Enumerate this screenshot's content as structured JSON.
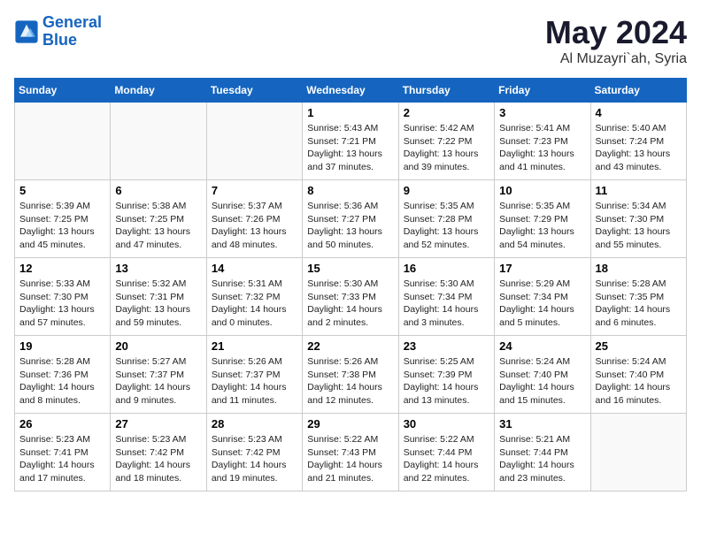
{
  "header": {
    "logo_line1": "General",
    "logo_line2": "Blue",
    "month": "May 2024",
    "location": "Al Muzayri`ah, Syria"
  },
  "weekdays": [
    "Sunday",
    "Monday",
    "Tuesday",
    "Wednesday",
    "Thursday",
    "Friday",
    "Saturday"
  ],
  "weeks": [
    [
      {
        "day": "",
        "info": ""
      },
      {
        "day": "",
        "info": ""
      },
      {
        "day": "",
        "info": ""
      },
      {
        "day": "1",
        "info": "Sunrise: 5:43 AM\nSunset: 7:21 PM\nDaylight: 13 hours\nand 37 minutes."
      },
      {
        "day": "2",
        "info": "Sunrise: 5:42 AM\nSunset: 7:22 PM\nDaylight: 13 hours\nand 39 minutes."
      },
      {
        "day": "3",
        "info": "Sunrise: 5:41 AM\nSunset: 7:23 PM\nDaylight: 13 hours\nand 41 minutes."
      },
      {
        "day": "4",
        "info": "Sunrise: 5:40 AM\nSunset: 7:24 PM\nDaylight: 13 hours\nand 43 minutes."
      }
    ],
    [
      {
        "day": "5",
        "info": "Sunrise: 5:39 AM\nSunset: 7:25 PM\nDaylight: 13 hours\nand 45 minutes."
      },
      {
        "day": "6",
        "info": "Sunrise: 5:38 AM\nSunset: 7:25 PM\nDaylight: 13 hours\nand 47 minutes."
      },
      {
        "day": "7",
        "info": "Sunrise: 5:37 AM\nSunset: 7:26 PM\nDaylight: 13 hours\nand 48 minutes."
      },
      {
        "day": "8",
        "info": "Sunrise: 5:36 AM\nSunset: 7:27 PM\nDaylight: 13 hours\nand 50 minutes."
      },
      {
        "day": "9",
        "info": "Sunrise: 5:35 AM\nSunset: 7:28 PM\nDaylight: 13 hours\nand 52 minutes."
      },
      {
        "day": "10",
        "info": "Sunrise: 5:35 AM\nSunset: 7:29 PM\nDaylight: 13 hours\nand 54 minutes."
      },
      {
        "day": "11",
        "info": "Sunrise: 5:34 AM\nSunset: 7:30 PM\nDaylight: 13 hours\nand 55 minutes."
      }
    ],
    [
      {
        "day": "12",
        "info": "Sunrise: 5:33 AM\nSunset: 7:30 PM\nDaylight: 13 hours\nand 57 minutes."
      },
      {
        "day": "13",
        "info": "Sunrise: 5:32 AM\nSunset: 7:31 PM\nDaylight: 13 hours\nand 59 minutes."
      },
      {
        "day": "14",
        "info": "Sunrise: 5:31 AM\nSunset: 7:32 PM\nDaylight: 14 hours\nand 0 minutes."
      },
      {
        "day": "15",
        "info": "Sunrise: 5:30 AM\nSunset: 7:33 PM\nDaylight: 14 hours\nand 2 minutes."
      },
      {
        "day": "16",
        "info": "Sunrise: 5:30 AM\nSunset: 7:34 PM\nDaylight: 14 hours\nand 3 minutes."
      },
      {
        "day": "17",
        "info": "Sunrise: 5:29 AM\nSunset: 7:34 PM\nDaylight: 14 hours\nand 5 minutes."
      },
      {
        "day": "18",
        "info": "Sunrise: 5:28 AM\nSunset: 7:35 PM\nDaylight: 14 hours\nand 6 minutes."
      }
    ],
    [
      {
        "day": "19",
        "info": "Sunrise: 5:28 AM\nSunset: 7:36 PM\nDaylight: 14 hours\nand 8 minutes."
      },
      {
        "day": "20",
        "info": "Sunrise: 5:27 AM\nSunset: 7:37 PM\nDaylight: 14 hours\nand 9 minutes."
      },
      {
        "day": "21",
        "info": "Sunrise: 5:26 AM\nSunset: 7:37 PM\nDaylight: 14 hours\nand 11 minutes."
      },
      {
        "day": "22",
        "info": "Sunrise: 5:26 AM\nSunset: 7:38 PM\nDaylight: 14 hours\nand 12 minutes."
      },
      {
        "day": "23",
        "info": "Sunrise: 5:25 AM\nSunset: 7:39 PM\nDaylight: 14 hours\nand 13 minutes."
      },
      {
        "day": "24",
        "info": "Sunrise: 5:24 AM\nSunset: 7:40 PM\nDaylight: 14 hours\nand 15 minutes."
      },
      {
        "day": "25",
        "info": "Sunrise: 5:24 AM\nSunset: 7:40 PM\nDaylight: 14 hours\nand 16 minutes."
      }
    ],
    [
      {
        "day": "26",
        "info": "Sunrise: 5:23 AM\nSunset: 7:41 PM\nDaylight: 14 hours\nand 17 minutes."
      },
      {
        "day": "27",
        "info": "Sunrise: 5:23 AM\nSunset: 7:42 PM\nDaylight: 14 hours\nand 18 minutes."
      },
      {
        "day": "28",
        "info": "Sunrise: 5:23 AM\nSunset: 7:42 PM\nDaylight: 14 hours\nand 19 minutes."
      },
      {
        "day": "29",
        "info": "Sunrise: 5:22 AM\nSunset: 7:43 PM\nDaylight: 14 hours\nand 21 minutes."
      },
      {
        "day": "30",
        "info": "Sunrise: 5:22 AM\nSunset: 7:44 PM\nDaylight: 14 hours\nand 22 minutes."
      },
      {
        "day": "31",
        "info": "Sunrise: 5:21 AM\nSunset: 7:44 PM\nDaylight: 14 hours\nand 23 minutes."
      },
      {
        "day": "",
        "info": ""
      }
    ]
  ]
}
